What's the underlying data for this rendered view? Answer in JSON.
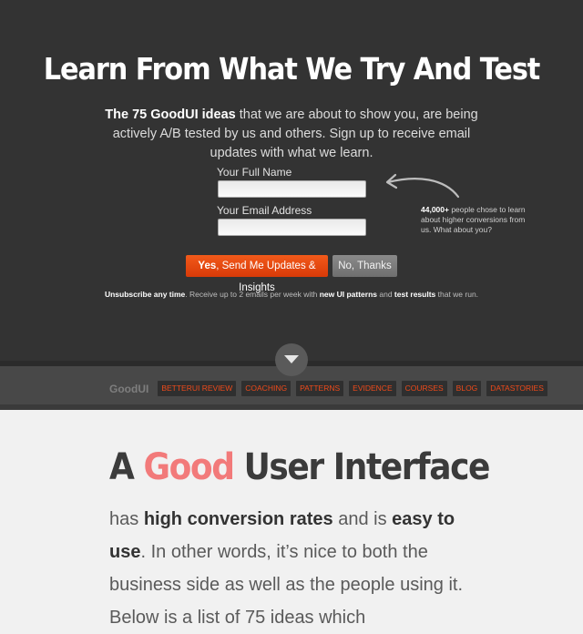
{
  "hero": {
    "title": "Learn From What We Try And Test",
    "subtitle_strong": "The 75 GoodUI ideas",
    "subtitle_rest": " that we are about to show you, are being actively A/B tested by us and others. Sign up to receive email updates with what we learn."
  },
  "form": {
    "name_label": "Your Full Name",
    "name_value": "",
    "email_label": "Your Email Address",
    "email_value": ""
  },
  "count_note": {
    "strong": "44,000+",
    "rest": " people chose to learn about higher conversions from us. What about you?"
  },
  "buttons": {
    "yes_strong": "Yes",
    "yes_rest": ", Send Me Updates & Insights",
    "no": "No, Thanks"
  },
  "fineprint": {
    "p1": "Unsubscribe any time",
    "p2": ". Receive up to 2 emails per week with ",
    "p3": "new UI patterns",
    "p4": " and ",
    "p5": "test results",
    "p6": " that we run."
  },
  "nav": {
    "brand": "GoodUI",
    "items": [
      "BETTERUI REVIEW",
      "COACHING",
      "PATTERNS",
      "EVIDENCE",
      "COURSES",
      "BLOG",
      "DATASTORIES"
    ]
  },
  "content": {
    "title_a": "A ",
    "title_good": "Good",
    "title_rest": " User Interface",
    "b1": "has ",
    "b2": "high conversion rates",
    "b3": " and is ",
    "b4": "easy to use",
    "b5": ". In other words, it’s nice to both the business side as well as the people using it. Below is a list of 75 ideas which"
  },
  "colors": {
    "hero_bg": "#333333",
    "accent_orange": "#e8450f",
    "title_good": "#f27a7a",
    "content_bg": "#f1f1f1"
  },
  "icons": [
    "curved-arrow-icon",
    "chevron-down-icon"
  ]
}
